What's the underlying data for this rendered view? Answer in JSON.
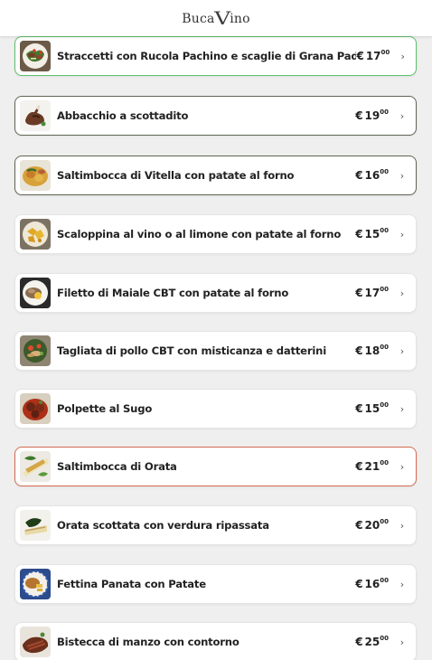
{
  "header": {
    "logo_part1": "Buca",
    "logo_v": "V",
    "logo_part2": "ino"
  },
  "menu": [
    {
      "name": "Straccetti con Rucola Pachino e scaglie di Grana Padano",
      "currency": "€",
      "price": "17",
      "cents": "00",
      "chevron": "›",
      "border": "green",
      "thumb": "beef-rucola"
    },
    {
      "name": "Abbacchio a scottadito",
      "currency": "€",
      "price": "19",
      "cents": "00",
      "chevron": "›",
      "border": "dark",
      "thumb": "lamb"
    },
    {
      "name": "Saltimbocca di Vitella con patate al forno",
      "currency": "€",
      "price": "16",
      "cents": "00",
      "chevron": "›",
      "border": "dark",
      "thumb": "saltimbocca"
    },
    {
      "name": "Scaloppina al vino o al limone con patate al forno",
      "currency": "€",
      "price": "15",
      "cents": "00",
      "chevron": "›",
      "border": "none",
      "thumb": "scaloppina"
    },
    {
      "name": "Filetto di Maiale CBT con patate al forno",
      "currency": "€",
      "price": "17",
      "cents": "00",
      "chevron": "›",
      "border": "none",
      "thumb": "pork"
    },
    {
      "name": "Tagliata di pollo CBT con misticanza e datterini",
      "currency": "€",
      "price": "18",
      "cents": "00",
      "chevron": "›",
      "border": "none",
      "thumb": "chicken"
    },
    {
      "name": "Polpette al Sugo",
      "currency": "€",
      "price": "15",
      "cents": "00",
      "chevron": "›",
      "border": "none",
      "thumb": "meatballs"
    },
    {
      "name": "Saltimbocca di Orata",
      "currency": "€",
      "price": "21",
      "cents": "00",
      "chevron": "›",
      "border": "red",
      "thumb": "orata"
    },
    {
      "name": "Orata scottata con verdura ripassata",
      "currency": "€",
      "price": "20",
      "cents": "00",
      "chevron": "›",
      "border": "none",
      "thumb": "orata-greens"
    },
    {
      "name": "Fettina Panata con Patate",
      "currency": "€",
      "price": "16",
      "cents": "00",
      "chevron": "›",
      "border": "none",
      "thumb": "cutlet"
    },
    {
      "name": "Bistecca di manzo con contorno",
      "currency": "€",
      "price": "25",
      "cents": "00",
      "chevron": "›",
      "border": "none",
      "thumb": "steak"
    }
  ]
}
